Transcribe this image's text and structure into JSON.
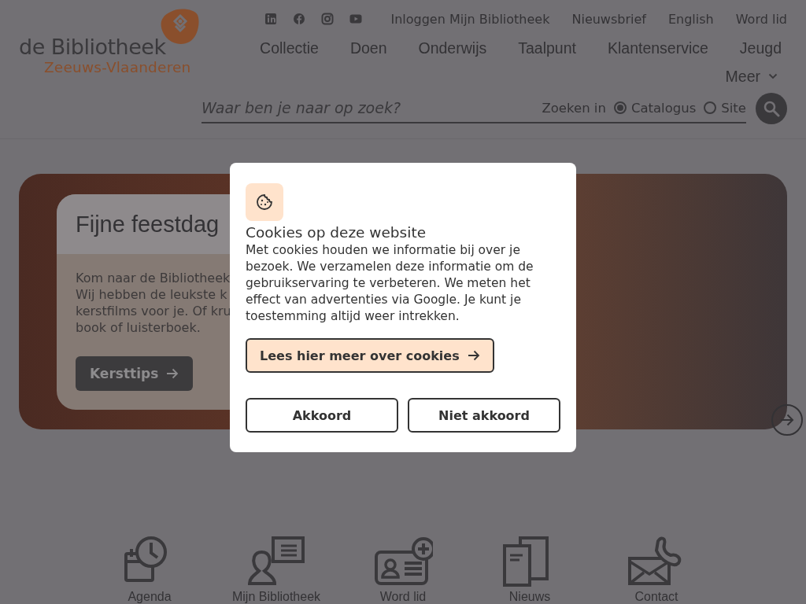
{
  "header": {
    "logo": {
      "title": "de Bibliotheek",
      "subtitle": "Zeeuws-Vlaanderen"
    },
    "social_links": [
      {
        "kind": "linkedin"
      },
      {
        "kind": "facebook"
      },
      {
        "kind": "instagram"
      },
      {
        "kind": "youtube"
      }
    ],
    "top_links": [
      "Inloggen Mijn Bibliotheek",
      "Nieuwsbrief",
      "English",
      "Word lid"
    ],
    "nav": [
      "Collectie",
      "Doen",
      "Onderwijs",
      "Taalpunt",
      "Klantenservice",
      "Jeugd"
    ],
    "more_menu": "Meer",
    "search": {
      "placeholder": "Waar ben je naar op zoek?",
      "scope_label": "Zoeken in",
      "scopes": [
        {
          "label": "Catalogus",
          "selected": true
        },
        {
          "label": "Site",
          "selected": false
        }
      ]
    }
  },
  "hero": {
    "title": "Fijne feestdag",
    "lines": [
      "Kom naar de Bibliotheek",
      "Wij hebben de leukste k",
      "kerstfilms voor je. Of kru",
      "book of luisterboek."
    ],
    "button": "Kersttips"
  },
  "cookie_dialog": {
    "title": "Cookies op deze website",
    "text": "Met cookies houden we informatie bij over je bezoek. We verzamelen deze informatie om de gebruikservaring te verbeteren. We meten het effect van advertenties via Google. Je kunt je toestemming altijd weer intrekken.",
    "buttons": [
      {
        "label": "Lees hier meer over cookies",
        "kind": "info"
      },
      {
        "label": "Akkoord",
        "kind": "choice"
      },
      {
        "label": "Niet akkoord",
        "kind": "choice"
      }
    ]
  },
  "quick_links": [
    {
      "label": "Agenda",
      "kind": "agenda"
    },
    {
      "label": "Mijn Bibliotheek",
      "kind": "account"
    },
    {
      "label": "Word lid",
      "kind": "membership"
    },
    {
      "label": "Nieuws",
      "kind": "news"
    },
    {
      "label": "Contact",
      "kind": "contact"
    }
  ]
}
